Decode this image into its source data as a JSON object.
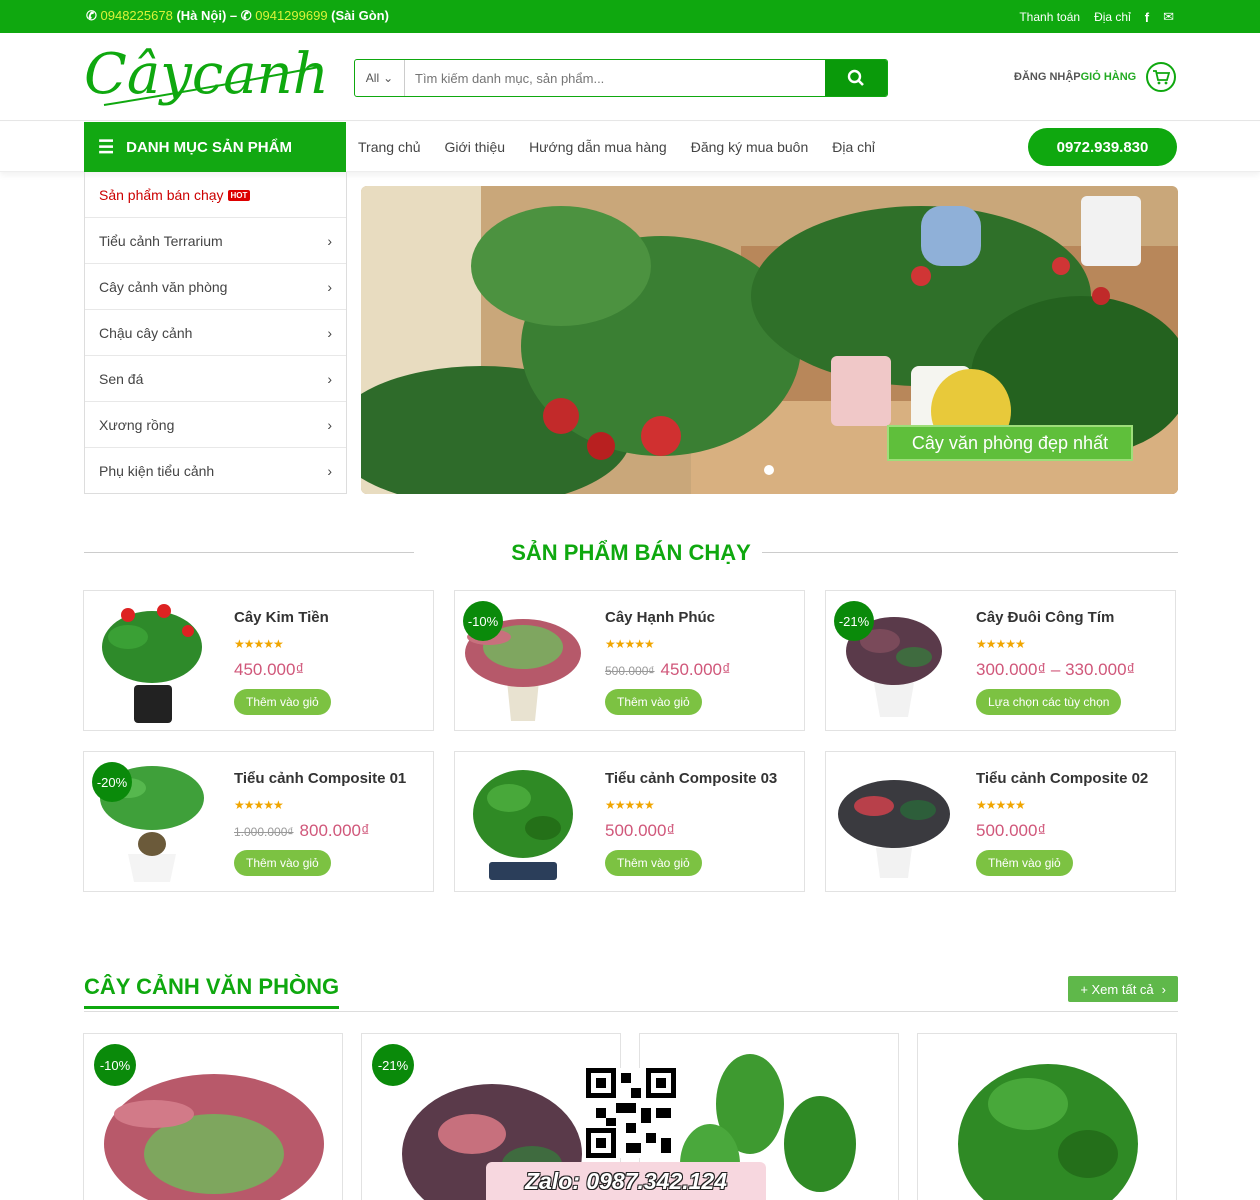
{
  "topbar": {
    "phone1": "0948225678",
    "city1": " (Hà Nội) – ",
    "phone2": "0941299699",
    "city2": " (Sài Gòn)",
    "payment": "Thanh toán",
    "address": "Địa chỉ"
  },
  "header": {
    "logo_text": "Câycanh",
    "search_category": "All",
    "search_placeholder": "Tìm kiếm danh mục, sản phẩm...",
    "login": "ĐĂNG NHẬP",
    "cart": "GIỎ HÀNG"
  },
  "nav": {
    "category_button": "DANH MỤC SẢN PHẨM",
    "items": [
      "Trang chủ",
      "Giới thiệu",
      "Hướng dẫn mua hàng",
      "Đăng ký mua buôn",
      "Địa chỉ"
    ],
    "hotline": "0972.939.830"
  },
  "sidebar": {
    "hot_item": "Sản phẩm bán chạy",
    "hot_badge": "HOT",
    "items": [
      "Tiểu cảnh Terrarium",
      "Cây cảnh văn phòng",
      "Chậu cây cảnh",
      "Sen đá",
      "Xương rồng",
      "Phụ kiện tiểu cảnh"
    ]
  },
  "banner": {
    "caption": "Cây văn phòng đẹp nhất"
  },
  "bestsellers": {
    "title": "SẢN PHẨM BÁN CHẠY",
    "products": [
      {
        "name": "Cây Kim Tiền",
        "badge": "",
        "old_price": "",
        "price": "450.000₫",
        "button": "Thêm vào giỏ"
      },
      {
        "name": "Cây Hạnh Phúc",
        "badge": "-10%",
        "old_price": "500.000₫",
        "price": "450.000₫",
        "button": "Thêm vào giỏ"
      },
      {
        "name": "Cây Đuôi Công Tím",
        "badge": "-21%",
        "old_price": "",
        "price": "300.000₫ – 330.000₫",
        "button": "Lựa chọn các tùy chọn"
      },
      {
        "name": "Tiểu cảnh Composite 01",
        "badge": "-20%",
        "old_price": "1.000.000₫",
        "price": "800.000₫",
        "button": "Thêm vào giỏ"
      },
      {
        "name": "Tiểu cảnh Composite 03",
        "badge": "",
        "old_price": "",
        "price": "500.000₫",
        "button": "Thêm vào giỏ"
      },
      {
        "name": "Tiểu cảnh Composite 02",
        "badge": "",
        "old_price": "",
        "price": "500.000₫",
        "button": "Thêm vào giỏ"
      }
    ],
    "stars": "★★★★★"
  },
  "office": {
    "title": "CÂY CẢNH VĂN PHÒNG",
    "view_all": "+ Xem tất cả",
    "badges": [
      "-10%",
      "-21%",
      "",
      ""
    ]
  },
  "overlay": {
    "zalo": "Zalo: 0987.342.124"
  },
  "colors": {
    "brand_green": "#0fa80f",
    "price_pink": "#d0577a",
    "button_green": "#7cc242"
  }
}
